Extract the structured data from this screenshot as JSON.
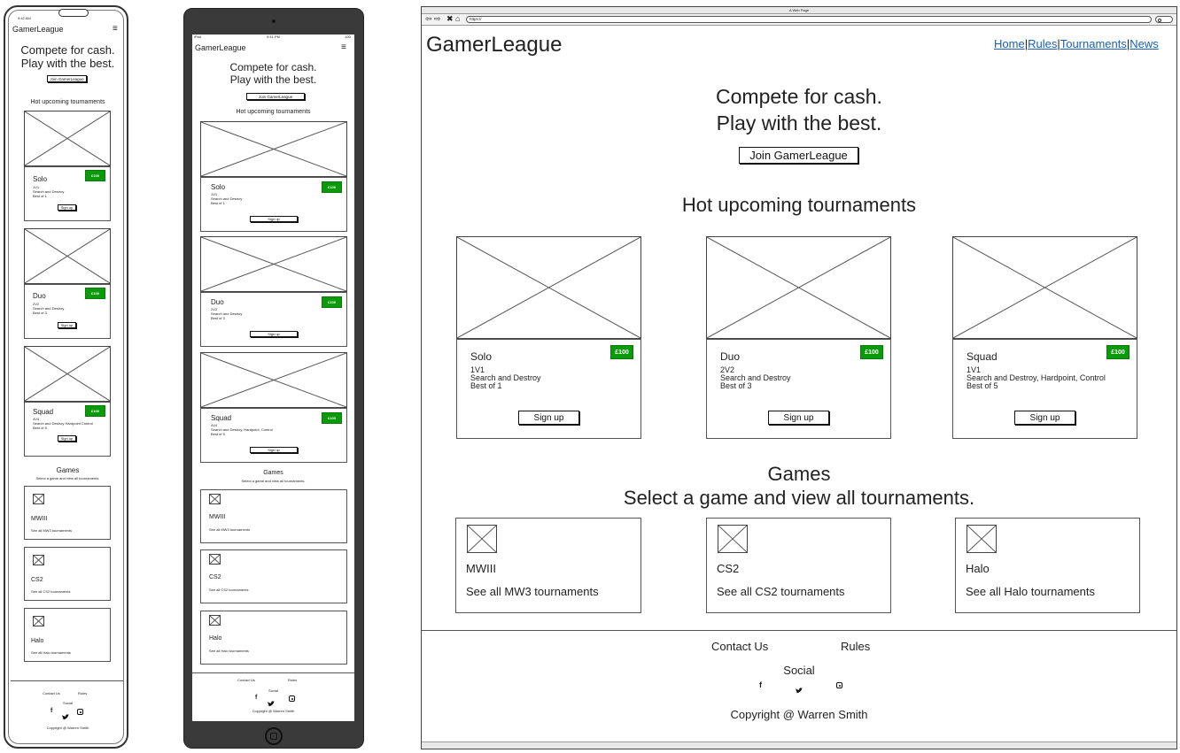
{
  "brand": "GamerLeague",
  "hero": {
    "line1": "Compete for cash.",
    "line2": "Play with the best.",
    "cta": "Join GamerLeague"
  },
  "section_title": "Hot upcoming tournaments",
  "tournaments": [
    {
      "name": "Solo",
      "mode": "1V1",
      "game_mode": "Search and Destroy",
      "format": "Best of 1",
      "prize": "£100",
      "button": "Sign up"
    },
    {
      "name": "Duo",
      "mode": "2V2",
      "game_mode": "Search and Destroy",
      "format": "Best of 3",
      "prize": "£100",
      "button": "Sign up"
    },
    {
      "name": "Squad",
      "mode": "1V1",
      "game_mode": "Search and Destroy, Hardpoint, Control",
      "format": "Best of 5",
      "prize": "£100",
      "button": "Sign up"
    }
  ],
  "squad_small": {
    "mode": "4V4",
    "game_mode_mobile": "Search and Destroy Hardpoint Control"
  },
  "games_title": "Games",
  "games_subtitle": "Select a game and view all tournaments.",
  "games": [
    {
      "name": "MWIII",
      "link": "See all MW3 tournaments"
    },
    {
      "name": "CS2",
      "link": "See all CS2 tournaments"
    },
    {
      "name": "Halo",
      "link": "See all Halo tournaments"
    }
  ],
  "footer": {
    "contact": "Contact Us",
    "rules": "Rules",
    "social": "Social",
    "copyright": "Copyright @ Warren Smith"
  },
  "nav": [
    "Home",
    "Rules",
    "Tournaments",
    "News"
  ],
  "browser": {
    "title": "A Web Page",
    "url": "https://"
  },
  "phone_status": {
    "time": "9:42 AM"
  },
  "tablet_status": {
    "left": "iPad",
    "time": "9:41 PM",
    "battery": "100"
  },
  "icons": {
    "facebook": "facebook-icon",
    "twitter": "twitter-icon",
    "instagram": "instagram-icon",
    "menu": "hamburger-menu-icon"
  },
  "colors": {
    "badge": "#0a9a0a",
    "link": "#1a5fb4"
  }
}
